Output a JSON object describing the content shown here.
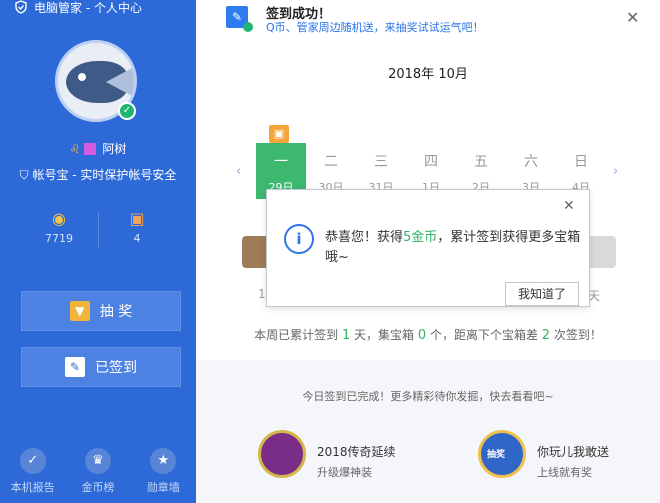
{
  "sidebar": {
    "title": "电脑管家 - 个人中心",
    "username": "阿树",
    "zodiac": "♌",
    "protect_text": "帐号宝 - 实时保护帐号安全",
    "coins": "7719",
    "gifts": "4",
    "lottery_label": "抽 奖",
    "signed_label": "已签到",
    "nav": [
      {
        "label": "本机报告",
        "icon": "shield-check-icon"
      },
      {
        "label": "金币榜",
        "icon": "crown-icon"
      },
      {
        "label": "勋章墙",
        "icon": "medal-icon"
      }
    ]
  },
  "toast": {
    "title": "签到成功！",
    "subtitle": "Q币、管家周边随机送，来抽奖试试运气吧！"
  },
  "calendar": {
    "month": "2018年 10月",
    "days": [
      {
        "weekday": "一",
        "date": "29日",
        "active": true
      },
      {
        "weekday": "二",
        "date": "30日",
        "active": false
      },
      {
        "weekday": "三",
        "date": "31日",
        "active": false
      },
      {
        "weekday": "四",
        "date": "1日",
        "active": false
      },
      {
        "weekday": "五",
        "date": "2日",
        "active": false
      },
      {
        "weekday": "六",
        "date": "3日",
        "active": false
      },
      {
        "weekday": "日",
        "date": "4日",
        "active": false
      }
    ],
    "left_chest_label": "1",
    "right_chest_label": "天"
  },
  "summary": {
    "p1": "本周已累计签到 ",
    "days": "1",
    "p2": " 天，集宝箱 ",
    "boxes": "0",
    "p3": " 个，距离下个宝箱差 ",
    "remaining": "2",
    "p4": " 次签到！"
  },
  "lower": {
    "title": "今日签到已完成！更多精彩待你发掘，快去看看吧~",
    "promos": [
      {
        "name": "2018传奇延续",
        "desc": "升级爆神装"
      },
      {
        "name": "你玩儿我敢送",
        "desc": "上线就有奖",
        "badge": "抽奖"
      }
    ]
  },
  "dialog": {
    "msg_prefix": "恭喜您！获得",
    "msg_highlight": "5金币",
    "msg_suffix": "，累计签到获得更多宝箱哦~",
    "button": "我知道了"
  },
  "colors": {
    "sidebar_bg": "#2d6ad8",
    "active_day": "#3db86f",
    "highlight_green": "#2fb167",
    "link_blue": "#2a73e8"
  }
}
